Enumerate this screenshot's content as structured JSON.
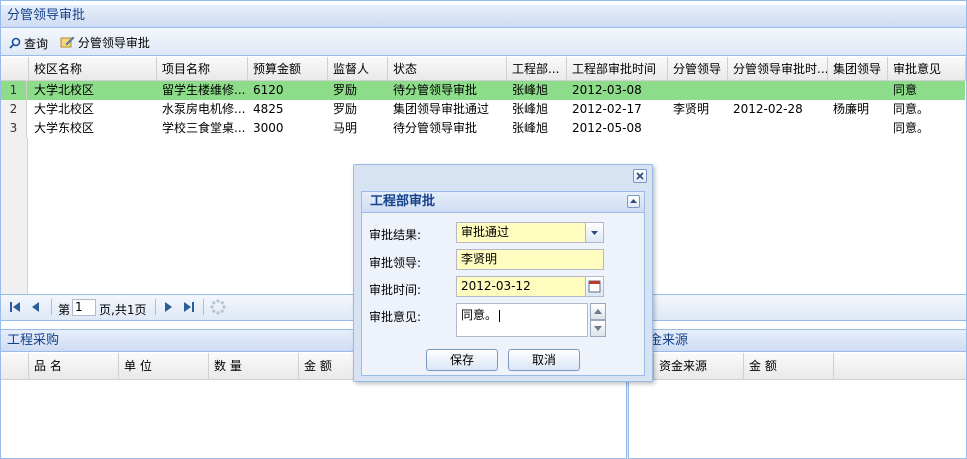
{
  "top_panel": {
    "title": "分管领导审批",
    "toolbar": {
      "query_label": "查询",
      "approve_label": "分管领导审批"
    },
    "columns": [
      "校区名称",
      "项目名称",
      "预算金额",
      "监督人",
      "状态",
      "工程部...",
      "工程部审批时间",
      "分管领导",
      "分管领导审批时...",
      "集团领导",
      "审批意见"
    ],
    "rows": [
      {
        "num": "1",
        "campus": "大学北校区",
        "project": "留学生楼维修...",
        "budget": "6120",
        "supervisor": "罗励",
        "status": "待分管领导审批",
        "eng": "张峰旭",
        "eng_time": "2012-03-08",
        "leader": "",
        "leader_time": "",
        "group_leader": "",
        "opinion": "同意"
      },
      {
        "num": "2",
        "campus": "大学北校区",
        "project": "水泵房电机修...",
        "budget": "4825",
        "supervisor": "罗励",
        "status": "集团领导审批通过",
        "eng": "张峰旭",
        "eng_time": "2012-02-17",
        "leader": "李贤明",
        "leader_time": "2012-02-28",
        "group_leader": "杨廉明",
        "opinion": "同意。"
      },
      {
        "num": "3",
        "campus": "大学东校区",
        "project": "学校三食堂桌...",
        "budget": "3000",
        "supervisor": "马明",
        "status": "待分管领导审批",
        "eng": "张峰旭",
        "eng_time": "2012-05-08",
        "leader": "",
        "leader_time": "",
        "group_leader": "",
        "opinion": "同意。"
      }
    ],
    "pager": {
      "page_prefix": "第",
      "page_value": "1",
      "page_suffix": "页,共1页"
    }
  },
  "bottom_left": {
    "title": "工程采购",
    "columns": [
      "品 名",
      "单 位",
      "数 量",
      "金 额"
    ]
  },
  "bottom_right": {
    "title": "金来源",
    "columns": [
      "资金来源",
      "金 额"
    ]
  },
  "dialog": {
    "section_title": "工程部审批",
    "fields": {
      "result_label": "审批结果:",
      "result_value": "审批通过",
      "leader_label": "审批领导:",
      "leader_value": "李贤明",
      "time_label": "审批时间:",
      "time_value": "2012-03-12",
      "opinion_label": "审批意见:",
      "opinion_value": "同意。"
    },
    "save_label": "保存",
    "cancel_label": "取消"
  },
  "colors": {
    "selected_row": "#8ddc8a",
    "input_bg": "#fffcc0",
    "title_text": "#15428b"
  },
  "icons": [
    "search-icon",
    "approve-icon",
    "first-page-icon",
    "prev-page-icon",
    "next-page-icon",
    "last-page-icon",
    "refresh-icon",
    "close-icon",
    "collapse-icon",
    "dropdown-icon",
    "calendar-icon",
    "spinner-up-icon",
    "spinner-down-icon"
  ]
}
